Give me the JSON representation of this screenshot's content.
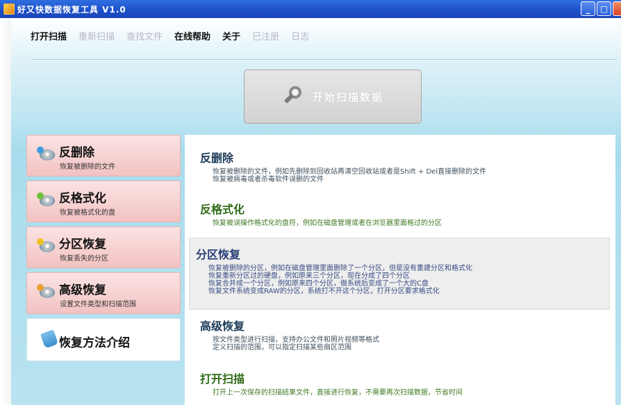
{
  "window": {
    "title": "好又快数据恢复工具 V1.0",
    "buttons": {
      "minimize": "_",
      "maximize": "□"
    }
  },
  "menu": [
    {
      "label": "打开扫描",
      "enabled": true
    },
    {
      "label": "重新扫描",
      "enabled": false
    },
    {
      "label": "查找文件",
      "enabled": false
    },
    {
      "label": "在线帮助",
      "enabled": true
    },
    {
      "label": "关于",
      "enabled": true
    },
    {
      "label": "已注册",
      "enabled": false
    },
    {
      "label": "日志",
      "enabled": false
    }
  ],
  "scan_button": {
    "label": "开始扫描数据",
    "icon": "magnifier-icon"
  },
  "nav": [
    {
      "title": "反删除",
      "subtitle": "恢复被删除的文件",
      "icon": "disc-undelete-icon",
      "badge": "#3a9be0"
    },
    {
      "title": "反格式化",
      "subtitle": "恢复被格式化的盘",
      "icon": "disc-unformat-icon",
      "badge": "#6bc23a"
    },
    {
      "title": "分区恢复",
      "subtitle": "恢复丢失的分区",
      "icon": "disc-partition-icon",
      "badge": "#f0c020"
    },
    {
      "title": "高级恢复",
      "subtitle": "设置文件类型和扫描范围",
      "icon": "disc-advanced-icon",
      "badge": "#e8a030"
    },
    {
      "title": "恢复方法介绍",
      "subtitle": "",
      "icon": "bottle-icon",
      "badge": ""
    }
  ],
  "sections": [
    {
      "title": "反删除",
      "lines": [
        "恢复被删除的文件，例如先删除到回收站再清空回收站或者是Shift + Del直接删除的文件",
        "恢复被病毒或者杀毒软件误删的文件"
      ]
    },
    {
      "title": "反格式化",
      "lines": [
        "恢复被误操作格式化的盘符，例如在磁盘管理或者在浏览器里面格过的分区"
      ]
    },
    {
      "title": "分区恢复",
      "lines": [
        "恢复被删除的分区，例如在磁盘管理里面删除了一个分区，但是没有重建分区和格式化",
        "恢复重新分区过的硬盘，例如原来三个分区，现在分成了四个分区",
        "恢复合并成一个分区，例如原来四个分区，做系统后变成了一个大的C盘",
        "恢复文件系统变成RAW的分区，系统打不开这个分区，打开分区要求格式化"
      ]
    },
    {
      "title": "高级恢复",
      "lines": [
        "按文件类型进行扫描，支持办公文件和照片视频等格式",
        "定义扫描的范围，可以指定扫描某些扇区范围"
      ]
    },
    {
      "title": "打开扫描",
      "lines": [
        "打开上一次保存的扫描结果文件，直接进行恢复，不需要再次扫描数据，节省时间"
      ]
    }
  ]
}
